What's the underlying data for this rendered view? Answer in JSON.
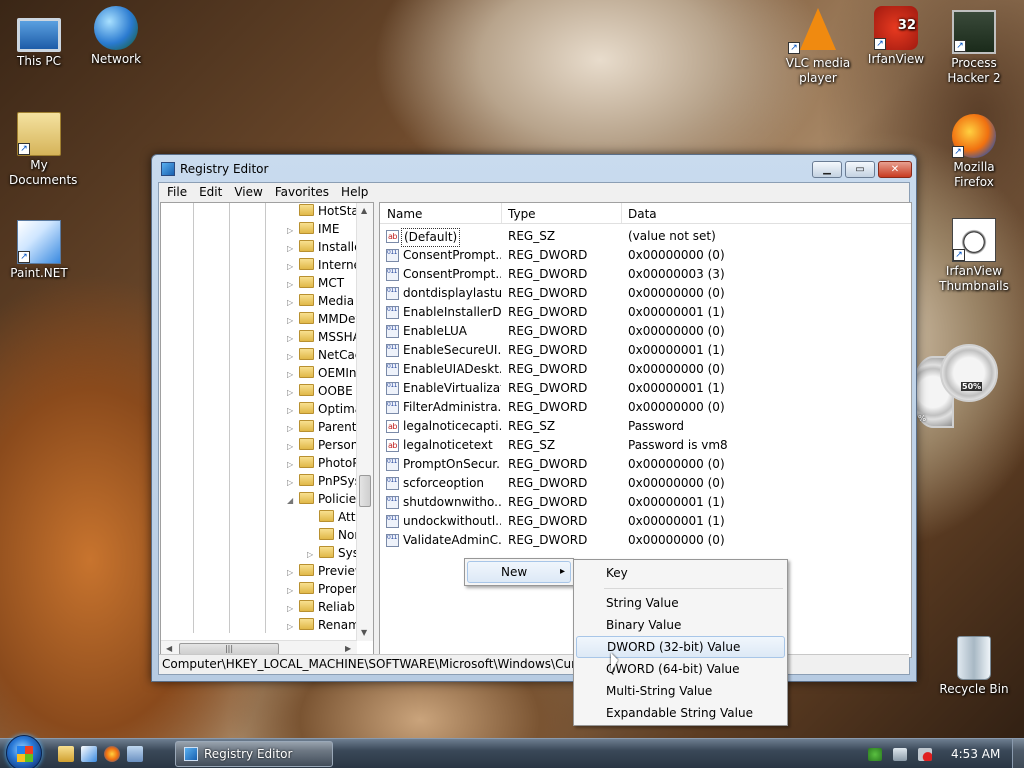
{
  "desktop": {
    "icons": [
      {
        "id": "this-pc",
        "label": "This PC"
      },
      {
        "id": "network",
        "label": "Network"
      },
      {
        "id": "my-documents",
        "label": "My Documents"
      },
      {
        "id": "paintnet",
        "label": "Paint.NET"
      },
      {
        "id": "vlc",
        "label": "VLC media player"
      },
      {
        "id": "irfanview",
        "label": "IrfanView",
        "badge": "32"
      },
      {
        "id": "process-hacker",
        "label": "Process Hacker 2"
      },
      {
        "id": "firefox",
        "label": "Mozilla Firefox"
      },
      {
        "id": "irfanview-thumbs",
        "label": "IrfanView Thumbnails"
      },
      {
        "id": "recycle-bin",
        "label": "Recycle Bin"
      }
    ],
    "gadget": {
      "percent": "50%",
      "side": "%"
    }
  },
  "window": {
    "title": "Registry Editor",
    "buttons": {
      "min": "▁",
      "max": "▭",
      "close": "✕"
    }
  },
  "menu": [
    "File",
    "Edit",
    "View",
    "Favorites",
    "Help"
  ],
  "tree": [
    {
      "label": "HotStar",
      "exp": ""
    },
    {
      "label": "IME",
      "exp": "▷"
    },
    {
      "label": "Installe",
      "exp": "▷"
    },
    {
      "label": "Interne",
      "exp": "▷"
    },
    {
      "label": "MCT",
      "exp": "▷"
    },
    {
      "label": "Media (",
      "exp": "▷"
    },
    {
      "label": "MMDev",
      "exp": "▷"
    },
    {
      "label": "MSSHA",
      "exp": "▷"
    },
    {
      "label": "NetCac",
      "exp": "▷"
    },
    {
      "label": "OEMInf",
      "exp": "▷"
    },
    {
      "label": "OOBE",
      "exp": "▷"
    },
    {
      "label": "Optima",
      "exp": "▷"
    },
    {
      "label": "Parenta",
      "exp": "▷"
    },
    {
      "label": "Person",
      "exp": "▷"
    },
    {
      "label": "PhotoP",
      "exp": "▷"
    },
    {
      "label": "PnPSys",
      "exp": "▷"
    },
    {
      "label": "Policies",
      "exp": "◢"
    },
    {
      "label": "Atta",
      "exp": ""
    },
    {
      "label": "Nor",
      "exp": ""
    },
    {
      "label": "Syst",
      "exp": "▷"
    },
    {
      "label": "Preview",
      "exp": "▷"
    },
    {
      "label": "Propert",
      "exp": "▷"
    },
    {
      "label": "Reliabi",
      "exp": "▷"
    },
    {
      "label": "Renam",
      "exp": "▷"
    }
  ],
  "columns": {
    "name": "Name",
    "type": "Type",
    "data": "Data"
  },
  "values": [
    {
      "name": "(Default)",
      "type": "REG_SZ",
      "data": "(value not set)",
      "kind": "sz"
    },
    {
      "name": "ConsentPrompt...",
      "type": "REG_DWORD",
      "data": "0x00000000 (0)",
      "kind": "dw"
    },
    {
      "name": "ConsentPrompt...",
      "type": "REG_DWORD",
      "data": "0x00000003 (3)",
      "kind": "dw"
    },
    {
      "name": "dontdisplaylastu...",
      "type": "REG_DWORD",
      "data": "0x00000000 (0)",
      "kind": "dw"
    },
    {
      "name": "EnableInstallerD...",
      "type": "REG_DWORD",
      "data": "0x00000001 (1)",
      "kind": "dw"
    },
    {
      "name": "EnableLUA",
      "type": "REG_DWORD",
      "data": "0x00000000 (0)",
      "kind": "dw"
    },
    {
      "name": "EnableSecureUI...",
      "type": "REG_DWORD",
      "data": "0x00000001 (1)",
      "kind": "dw"
    },
    {
      "name": "EnableUIADeskt...",
      "type": "REG_DWORD",
      "data": "0x00000000 (0)",
      "kind": "dw"
    },
    {
      "name": "EnableVirtualizat...",
      "type": "REG_DWORD",
      "data": "0x00000001 (1)",
      "kind": "dw"
    },
    {
      "name": "FilterAdministra...",
      "type": "REG_DWORD",
      "data": "0x00000000 (0)",
      "kind": "dw"
    },
    {
      "name": "legalnoticecapti...",
      "type": "REG_SZ",
      "data": "Password",
      "kind": "sz"
    },
    {
      "name": "legalnoticetext",
      "type": "REG_SZ",
      "data": "Password is vm8",
      "kind": "sz"
    },
    {
      "name": "PromptOnSecur...",
      "type": "REG_DWORD",
      "data": "0x00000000 (0)",
      "kind": "dw"
    },
    {
      "name": "scforceoption",
      "type": "REG_DWORD",
      "data": "0x00000000 (0)",
      "kind": "dw"
    },
    {
      "name": "shutdownwitho...",
      "type": "REG_DWORD",
      "data": "0x00000001 (1)",
      "kind": "dw"
    },
    {
      "name": "undockwithoutl...",
      "type": "REG_DWORD",
      "data": "0x00000001 (1)",
      "kind": "dw"
    },
    {
      "name": "ValidateAdminC...",
      "type": "REG_DWORD",
      "data": "0x00000000 (0)",
      "kind": "dw"
    }
  ],
  "icon_text": {
    "sz": "ab",
    "dw": "011 110"
  },
  "status_path": "Computer\\HKEY_LOCAL_MACHINE\\SOFTWARE\\Microsoft\\Windows\\CurrentV",
  "context": {
    "new": "New",
    "arrow": "▸",
    "submenu": [
      "Key",
      "String Value",
      "Binary Value",
      "DWORD (32-bit) Value",
      "QWORD (64-bit) Value",
      "Multi-String Value",
      "Expandable String Value"
    ],
    "highlighted": "DWORD (32-bit) Value"
  },
  "taskbar": {
    "task": "Registry Editor",
    "clock": "4:53 AM"
  },
  "colors": {
    "accent": "#3a8ae0",
    "selection": "#dde9f6"
  }
}
